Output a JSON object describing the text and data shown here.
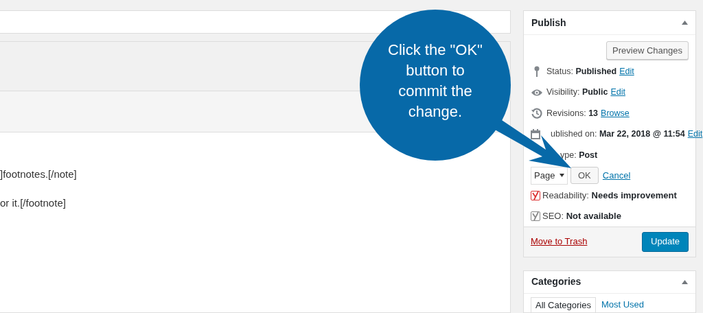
{
  "editor": {
    "lines": [
      "]footnotes.[/note]",
      "or it.[/footnote]"
    ]
  },
  "publish": {
    "title": "Publish",
    "preview_button": "Preview Changes",
    "rows": [
      {
        "kind": "pin",
        "label": "Status:",
        "value": "Published",
        "link": "Edit"
      },
      {
        "kind": "eye",
        "label": "Visibility:",
        "value": "Public",
        "link": "Edit"
      },
      {
        "kind": "history",
        "label": "Revisions:",
        "value": "13",
        "link": "Browse"
      },
      {
        "kind": "calendar",
        "label": "ublished on:",
        "value": "Mar 22, 2018 @ 11:54",
        "link": "Edit"
      },
      {
        "kind": "plain",
        "label": "ype:",
        "value": "Post"
      }
    ],
    "type_select": {
      "value": "Page",
      "ok": "OK",
      "cancel": "Cancel"
    },
    "yoast": [
      {
        "label": "Readability:",
        "value": "Needs improvement",
        "color": "#dc3232"
      },
      {
        "label": "SEO:",
        "value": "Not available",
        "color": "#888888"
      }
    ],
    "trash": "Move to Trash",
    "update": "Update"
  },
  "categories": {
    "title": "Categories",
    "tabs": [
      {
        "label": "All Categories",
        "selected": true
      },
      {
        "label": "Most Used",
        "selected": false
      }
    ]
  },
  "callout": {
    "text": "Click the \"OK\" button to commit the change."
  }
}
